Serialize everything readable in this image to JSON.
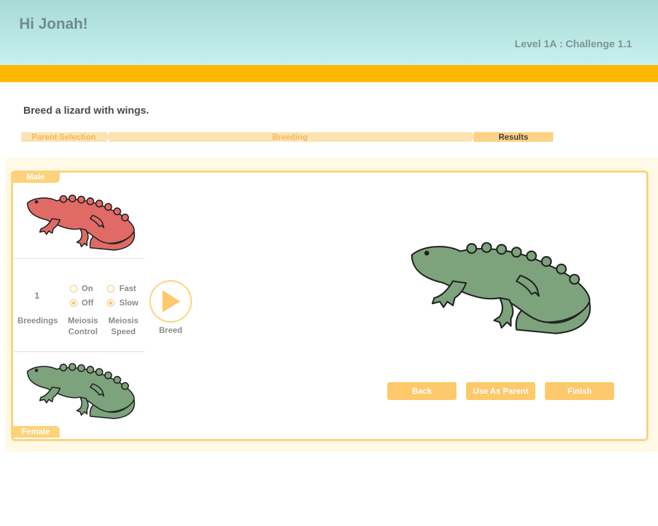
{
  "header": {
    "greeting": "Hi Jonah!",
    "level": "Level 1A : Challenge 1.1"
  },
  "instruction": "Breed a lizard with wings.",
  "steps": [
    {
      "label": "Parent Selection"
    },
    {
      "label": "Breeding"
    },
    {
      "label": "Results",
      "active": true
    }
  ],
  "parents": {
    "male_label": "Male",
    "female_label": "Female",
    "male_color": "#e06b66",
    "female_color": "#7da37c"
  },
  "controls": {
    "breedings_count": "1",
    "breedings_label": "Breedings",
    "meiosis_control_label": "Meiosis Control",
    "meiosis_speed_label": "Meiosis Speed",
    "control_on": "On",
    "control_off": "Off",
    "control_selected": "Off",
    "speed_fast": "Fast",
    "speed_slow": "Slow",
    "speed_selected": "Slow",
    "breed_label": "Breed"
  },
  "result": {
    "offspring_color": "#7da37c"
  },
  "buttons": {
    "back": "Back",
    "use_as_parent": "Use As Parent",
    "finish": "Finish"
  },
  "colors": {
    "accent": "#ffb800",
    "panel_border": "#fdd27a",
    "button": "#fdc96a"
  }
}
